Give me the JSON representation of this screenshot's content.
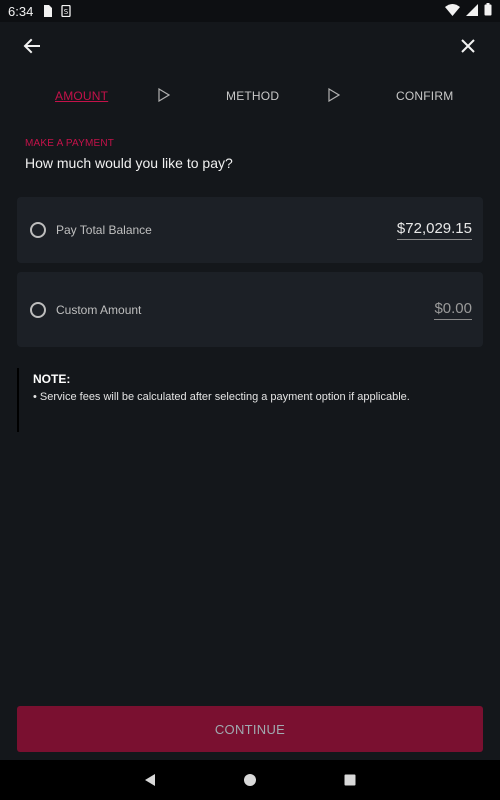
{
  "status_bar": {
    "time": "6:34",
    "icons": [
      "sim-card-icon",
      "sd-card-icon",
      "wifi-icon",
      "signal-icon",
      "battery-icon"
    ]
  },
  "app_bar": {
    "back_icon": "arrow-left-icon",
    "close_icon": "close-icon"
  },
  "stepper": {
    "steps": [
      {
        "label": "AMOUNT",
        "active": true
      },
      {
        "label": "METHOD",
        "active": false
      },
      {
        "label": "CONFIRM",
        "active": false
      }
    ],
    "separator_icon": "play-outline-icon"
  },
  "section": {
    "label": "MAKE A PAYMENT",
    "question": "How much would you like to pay?"
  },
  "options": [
    {
      "label": "Pay Total Balance",
      "amount": "$72,029.15",
      "selected": false
    },
    {
      "label": "Custom Amount",
      "amount": "$0.00",
      "selected": false
    }
  ],
  "note": {
    "title": "NOTE:",
    "text": "• Service fees will be calculated after selecting a payment option if applicable."
  },
  "continue_button": {
    "label": "CONTINUE",
    "enabled": false
  },
  "colors": {
    "accent": "#c4124a",
    "button_bg": "#7a1030",
    "background": "#14171b",
    "card": "#1c2026"
  },
  "nav_bar": {
    "icons": [
      "back-triangle-icon",
      "home-circle-icon",
      "recents-square-icon"
    ]
  }
}
